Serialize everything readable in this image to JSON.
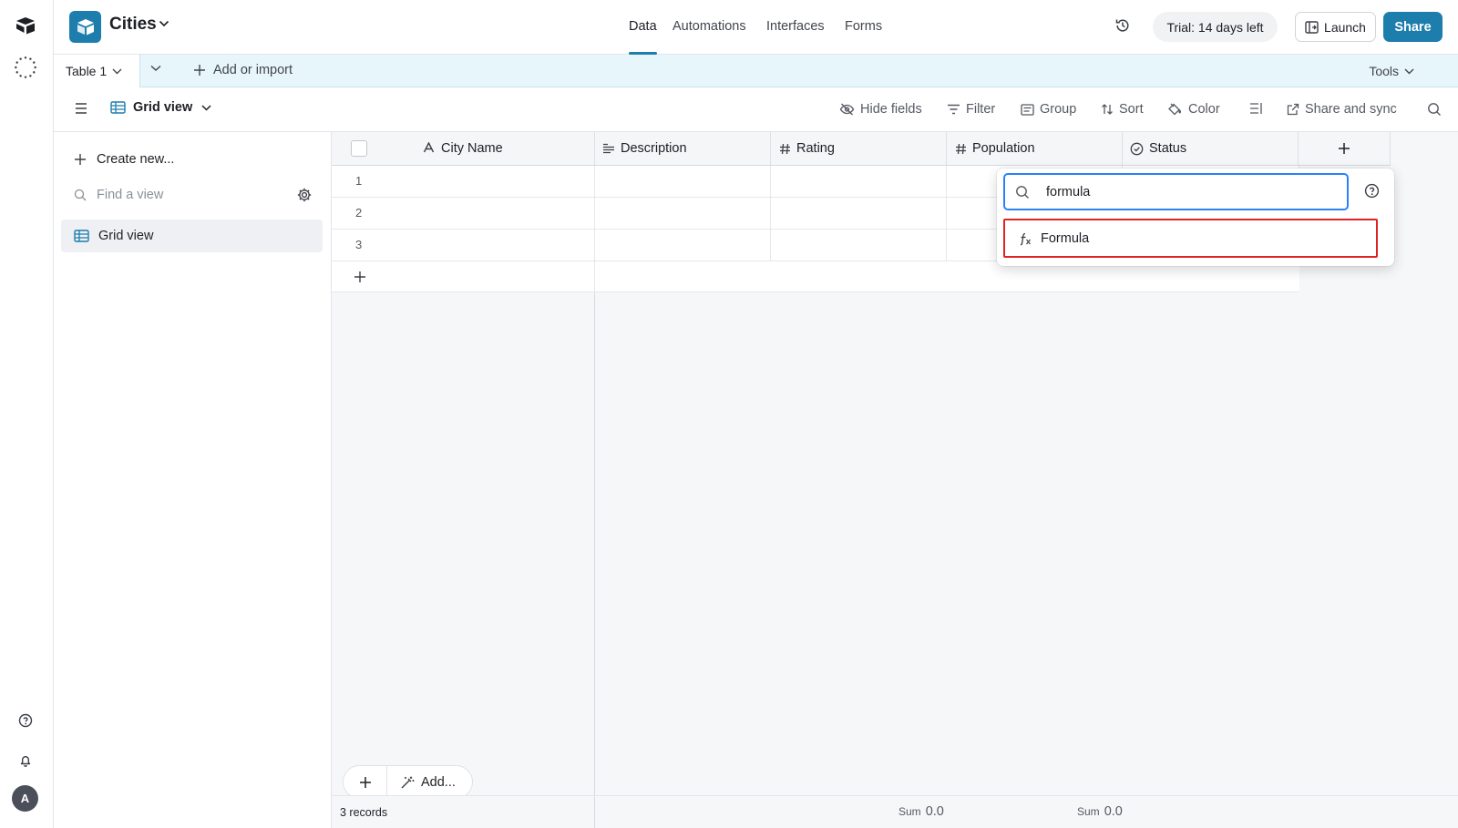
{
  "base": {
    "name": "Cities"
  },
  "nav": {
    "tabs": [
      {
        "label": "Data"
      },
      {
        "label": "Automations"
      },
      {
        "label": "Interfaces"
      },
      {
        "label": "Forms"
      }
    ]
  },
  "header": {
    "trial": "Trial: 14 days left",
    "launch": "Launch",
    "share": "Share"
  },
  "tabs": {
    "table": "Table 1",
    "add_import": "Add or import",
    "tools": "Tools"
  },
  "viewbar": {
    "view_name": "Grid view",
    "hide_fields": "Hide fields",
    "filter": "Filter",
    "group": "Group",
    "sort": "Sort",
    "color": "Color",
    "share_sync": "Share and sync"
  },
  "sidebar": {
    "create_new": "Create new...",
    "find_placeholder": "Find a view",
    "views": [
      {
        "label": "Grid view"
      }
    ]
  },
  "grid": {
    "columns": [
      {
        "label": "City Name",
        "icon": "text-type-icon"
      },
      {
        "label": "Description",
        "icon": "long-text-icon"
      },
      {
        "label": "Rating",
        "icon": "number-icon"
      },
      {
        "label": "Population",
        "icon": "number-icon"
      },
      {
        "label": "Status",
        "icon": "status-icon"
      }
    ],
    "rows": [
      "1",
      "2",
      "3"
    ],
    "record_count": "3 records",
    "add_label": "Add...",
    "summary": [
      {
        "label": "Sum",
        "value": "0.0"
      },
      {
        "label": "Sum",
        "value": "0.0"
      }
    ]
  },
  "dropdown": {
    "search_value": "formula",
    "result": "Formula"
  },
  "user": {
    "initial": "A"
  },
  "colors": {
    "accent": "#1d7dac",
    "focus": "#2d7ff9",
    "highlight": "#e02424",
    "tabbar": "#e7f6fb"
  }
}
